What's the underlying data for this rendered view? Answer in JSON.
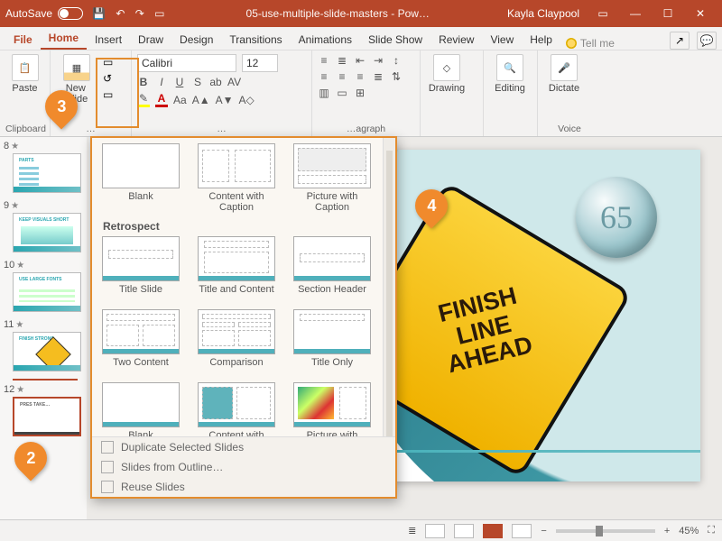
{
  "titlebar": {
    "autosave_label": "AutoSave",
    "doc_title": "05-use-multiple-slide-masters - Pow…",
    "user_name": "Kayla Claypool"
  },
  "menubar": {
    "file": "File",
    "home": "Home",
    "insert": "Insert",
    "draw": "Draw",
    "design": "Design",
    "transitions": "Transitions",
    "animations": "Animations",
    "slideshow": "Slide Show",
    "review": "Review",
    "view": "View",
    "help": "Help",
    "tellme": "Tell me"
  },
  "ribbon": {
    "clipboard": {
      "paste": "Paste",
      "group": "Clipboard"
    },
    "slides": {
      "new_slide": "New\nSlide",
      "group": "…"
    },
    "font": {
      "family": "Calibri",
      "size": "12"
    },
    "paragraph_group": "…agraph",
    "drawing_group": "Drawing",
    "editing_group": "Editing",
    "voice": {
      "dictate": "Dictate",
      "group": "Voice"
    }
  },
  "thumbs": {
    "n8": "8",
    "n9": "9",
    "n10": "10",
    "n11": "11",
    "n12": "12"
  },
  "layouts": {
    "row0": {
      "blank": "Blank",
      "cwc": "Content with\nCaption",
      "pwc": "Picture with\nCaption"
    },
    "section": "Retrospect",
    "row1": {
      "title": "Title Slide",
      "tac": "Title and Content",
      "sh": "Section Header"
    },
    "row2": {
      "two": "Two Content",
      "comp": "Comparison",
      "to": "Title Only"
    },
    "row3": {
      "blank": "Blank",
      "cwc": "Content with\nCaption",
      "pwc": "Picture with\nCaption"
    },
    "footer": {
      "dup": "Duplicate Selected Slides",
      "outline": "Slides from Outline…",
      "reuse": "Reuse Slides"
    }
  },
  "slide": {
    "sign_l1": "FINISH",
    "sign_l2": "LINE",
    "sign_l3": "AHEAD"
  },
  "markers": {
    "m2": "2",
    "m3": "3",
    "m4": "4"
  },
  "status": {
    "zoom": "45%"
  }
}
